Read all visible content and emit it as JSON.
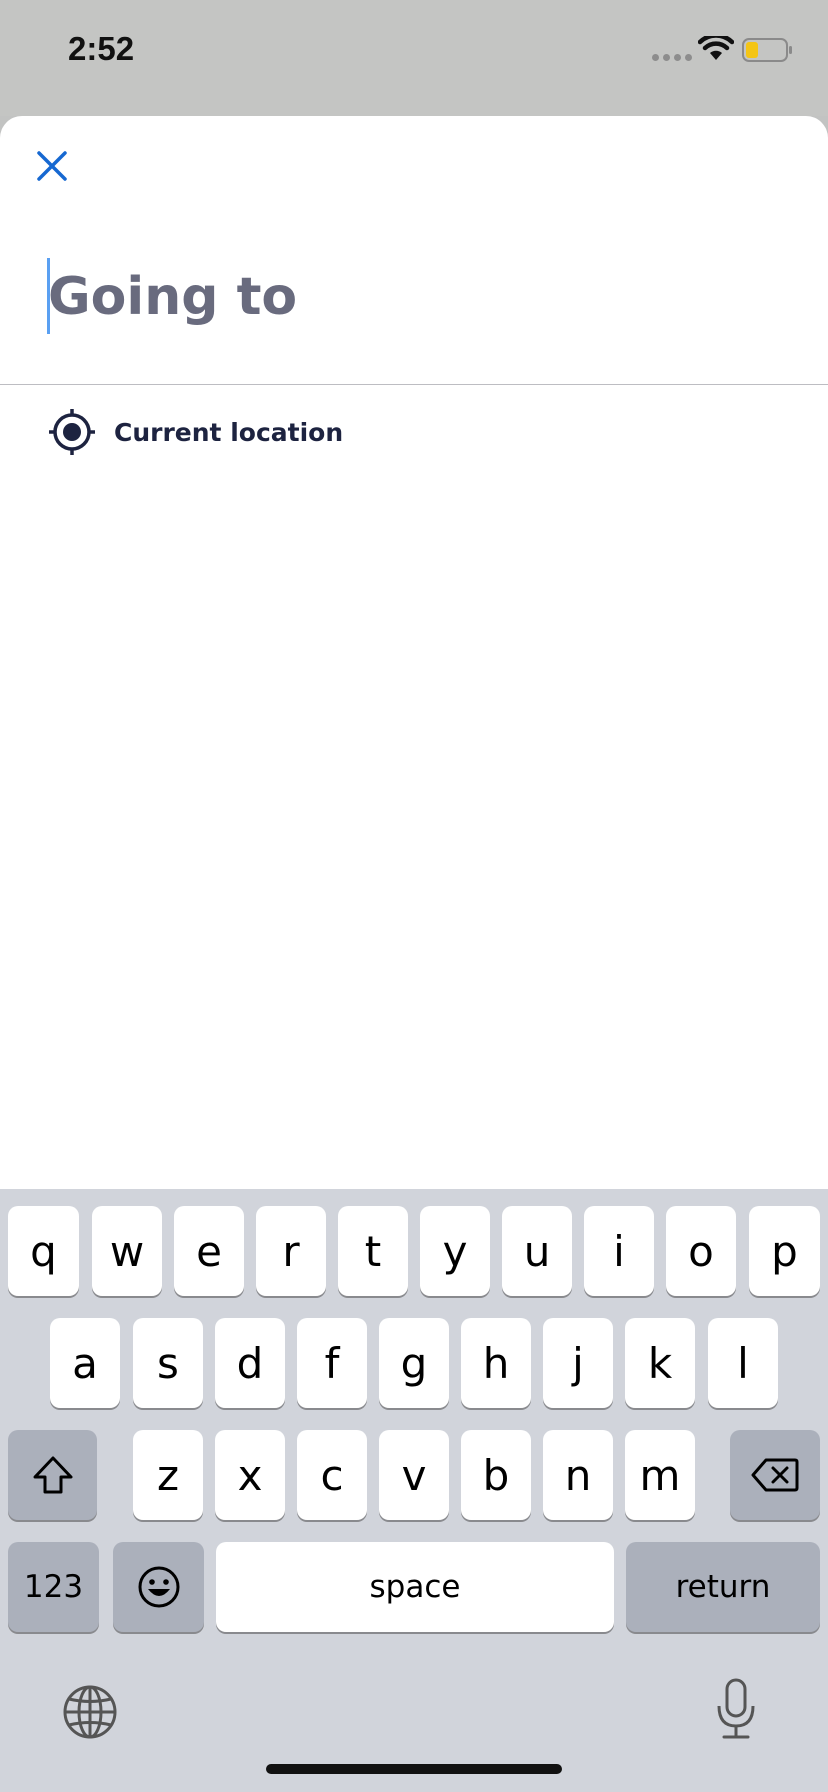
{
  "status_bar": {
    "time": "2:52",
    "icons": [
      "signal-dots-icon",
      "wifi-icon",
      "battery-icon"
    ],
    "battery_color": "#f4c515"
  },
  "header": {
    "close_icon": "close-icon",
    "accent_color": "#1668d1"
  },
  "search": {
    "placeholder": "Going to",
    "value": ""
  },
  "suggestions": [
    {
      "label": "Current location",
      "icon": "crosshair-icon"
    }
  ],
  "keyboard": {
    "row1": [
      "q",
      "w",
      "e",
      "r",
      "t",
      "y",
      "u",
      "i",
      "o",
      "p"
    ],
    "row2": [
      "a",
      "s",
      "d",
      "f",
      "g",
      "h",
      "j",
      "k",
      "l"
    ],
    "row3": [
      "z",
      "x",
      "c",
      "v",
      "b",
      "n",
      "m"
    ],
    "numbers_label": "123",
    "space_label": "space",
    "return_label": "return",
    "icons": [
      "shift-icon",
      "backspace-icon",
      "emoji-icon",
      "globe-icon",
      "microphone-icon"
    ]
  }
}
